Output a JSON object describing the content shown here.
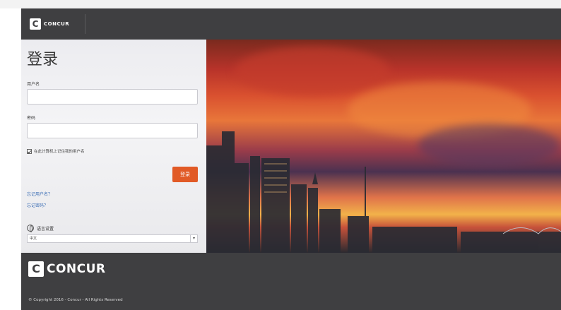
{
  "header": {
    "logo_letter": "C",
    "logo_text": "CONCUR"
  },
  "login": {
    "title": "登录",
    "username_label": "用户名",
    "password_label": "密码",
    "remember_label": "在此计算机上记住我的用户名",
    "submit_label": "登录",
    "forgot_username": "忘记用户名？",
    "forgot_password": "忘记密码？",
    "language_label": "语言设置",
    "language_value": "中文"
  },
  "footer": {
    "logo_letter": "C",
    "logo_text": "CONCUR",
    "copyright": "© Copyright 2016 - Concur - All Rights Reserved"
  },
  "colors": {
    "header_bg": "#3f3f41",
    "accent": "#e15a26",
    "link": "#3d6fb5"
  }
}
